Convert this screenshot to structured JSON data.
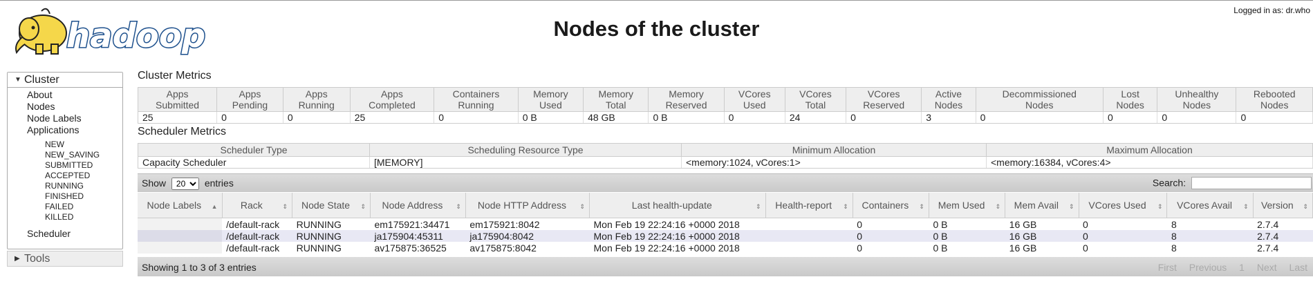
{
  "header": {
    "title": "Nodes of the cluster",
    "logged_in": "Logged in as: dr.who",
    "logo_text": "hadoop"
  },
  "sidebar": {
    "cluster_label": "Cluster",
    "items": [
      "About",
      "Nodes",
      "Node Labels",
      "Applications"
    ],
    "app_states": [
      "NEW",
      "NEW_SAVING",
      "SUBMITTED",
      "ACCEPTED",
      "RUNNING",
      "FINISHED",
      "FAILED",
      "KILLED"
    ],
    "scheduler": "Scheduler",
    "tools_label": "Tools"
  },
  "cluster_metrics": {
    "heading": "Cluster Metrics",
    "headers": [
      [
        "Apps",
        "Submitted"
      ],
      [
        "Apps",
        "Pending"
      ],
      [
        "Apps",
        "Running"
      ],
      [
        "Apps",
        "Completed"
      ],
      [
        "Containers",
        "Running"
      ],
      [
        "Memory",
        "Used"
      ],
      [
        "Memory",
        "Total"
      ],
      [
        "Memory",
        "Reserved"
      ],
      [
        "VCores",
        "Used"
      ],
      [
        "VCores",
        "Total"
      ],
      [
        "VCores",
        "Reserved"
      ],
      [
        "Active",
        "Nodes"
      ],
      [
        "Decommissioned",
        "Nodes"
      ],
      [
        "Lost",
        "Nodes"
      ],
      [
        "Unhealthy",
        "Nodes"
      ],
      [
        "Rebooted",
        "Nodes"
      ]
    ],
    "values": [
      "25",
      "0",
      "0",
      "25",
      "0",
      "0 B",
      "48 GB",
      "0 B",
      "0",
      "24",
      "0",
      "3",
      "0",
      "0",
      "0",
      "0"
    ]
  },
  "scheduler_metrics": {
    "heading": "Scheduler Metrics",
    "headers": [
      "Scheduler Type",
      "Scheduling Resource Type",
      "Minimum Allocation",
      "Maximum Allocation"
    ],
    "values": [
      "Capacity Scheduler",
      "[MEMORY]",
      "<memory:1024, vCores:1>",
      "<memory:16384, vCores:4>"
    ]
  },
  "controls": {
    "show": "Show",
    "page_size": "20",
    "entries": "entries",
    "search_label": "Search:"
  },
  "nodes_table": {
    "headers": [
      {
        "l1": "Node Labels",
        "l2": ""
      },
      {
        "l1": "Rack",
        "l2": ""
      },
      {
        "l1": "Node State",
        "l2": ""
      },
      {
        "l1": "Node Address",
        "l2": ""
      },
      {
        "l1": "Node HTTP Address",
        "l2": ""
      },
      {
        "l1": "Last health-update",
        "l2": ""
      },
      {
        "l1": "Health-report",
        "l2": ""
      },
      {
        "l1": "Containers",
        "l2": ""
      },
      {
        "l1": "Mem Used",
        "l2": ""
      },
      {
        "l1": "Mem Avail",
        "l2": ""
      },
      {
        "l1": "VCores Used",
        "l2": ""
      },
      {
        "l1": "VCores Avail",
        "l2": ""
      },
      {
        "l1": "Version",
        "l2": ""
      }
    ],
    "rows": [
      [
        "",
        "/default-rack",
        "RUNNING",
        "em175921:34471",
        "em175921:8042",
        "Mon Feb 19 22:24:16 +0000 2018",
        "",
        "0",
        "0 B",
        "16 GB",
        "0",
        "8",
        "2.7.4"
      ],
      [
        "",
        "/default-rack",
        "RUNNING",
        "ja175904:45311",
        "ja175904:8042",
        "Mon Feb 19 22:24:16 +0000 2018",
        "",
        "0",
        "0 B",
        "16 GB",
        "0",
        "8",
        "2.7.4"
      ],
      [
        "",
        "/default-rack",
        "RUNNING",
        "av175875:36525",
        "av175875:8042",
        "Mon Feb 19 22:24:16 +0000 2018",
        "",
        "0",
        "0 B",
        "16 GB",
        "0",
        "8",
        "2.7.4"
      ]
    ]
  },
  "footer": {
    "info": "Showing 1 to 3 of 3 entries",
    "first": "First",
    "previous": "Previous",
    "page": "1",
    "next": "Next",
    "last": "Last"
  }
}
